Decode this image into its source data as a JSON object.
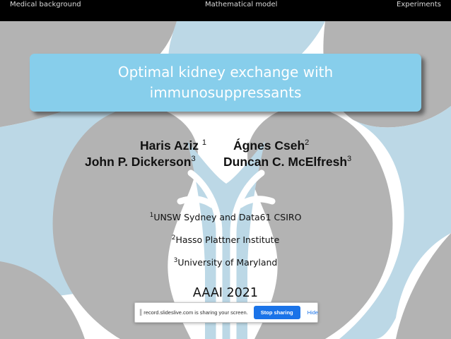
{
  "nav": {
    "items": [
      "Medical background",
      "Mathematical model",
      "Experiments"
    ]
  },
  "title": {
    "line1": "Optimal kidney exchange with",
    "line2": "immunosuppressants"
  },
  "authors": [
    {
      "name": "Haris Aziz",
      "sup": "1"
    },
    {
      "name": "Ágnes Cseh",
      "sup": "2"
    },
    {
      "name": "John P. Dickerson",
      "sup": "3"
    },
    {
      "name": "Duncan C. McElfresh",
      "sup": "3"
    }
  ],
  "affiliations": [
    {
      "sup": "1",
      "text": "UNSW Sydney and Data61 CSIRO"
    },
    {
      "sup": "2",
      "text": "Hasso Plattner Institute"
    },
    {
      "sup": "3",
      "text": "University of Maryland"
    }
  ],
  "venue": "AAAI 2021",
  "share_bar": {
    "handle": "||",
    "message": "record.slideslive.com is sharing your screen.",
    "stop_label": "Stop sharing",
    "hide_label": "Hide"
  },
  "colors": {
    "title_box": "#87ceeb",
    "shape_gray": "#b3b3b3",
    "shape_blue": "#bcd8e6",
    "navbar": "#000000",
    "button_blue": "#1a73e8"
  }
}
